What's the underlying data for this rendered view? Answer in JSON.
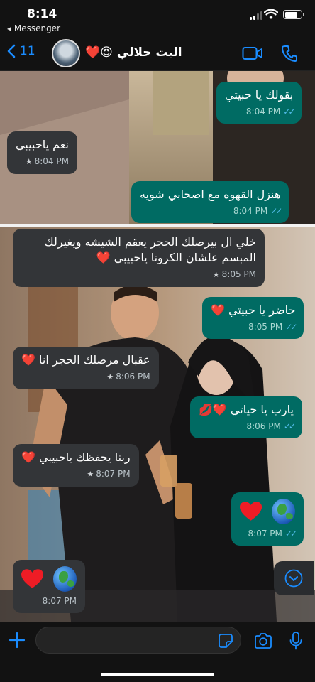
{
  "status_bar": {
    "time": "8:14",
    "back_app": "◂ Messenger"
  },
  "header": {
    "back_count": "11",
    "contact_name": "البت حلالي 😍❤️"
  },
  "messages": [
    {
      "dir": "out",
      "text": "بقولك يا حبيتي",
      "time": "8:04 PM"
    },
    {
      "dir": "in",
      "text": "نعم ياحبيبي",
      "time": "8:04 PM",
      "starred": true
    },
    {
      "dir": "out",
      "text": "هنزل القهوه مع اصحابي شويه",
      "time": "8:04 PM"
    },
    {
      "dir": "in",
      "text_line1": "خلي ال بيرصلك الحجر يعقم الشيشه ويغيرلك",
      "text_line2": "المبسم علشان الكرونا ياحبيبي ❤️",
      "time": "8:05 PM",
      "starred": true
    },
    {
      "dir": "out",
      "text": "حاضر يا حبيتي ❤️",
      "time": "8:05 PM"
    },
    {
      "dir": "in",
      "text": "عقبال مرصلك الحجر انا ❤️",
      "time": "8:06 PM",
      "starred": true
    },
    {
      "dir": "out",
      "text": "يارب يا حياتي ❤️💋",
      "time": "8:06 PM"
    },
    {
      "dir": "in",
      "text": "ربنا يحفظك ياحبيبي ❤️",
      "time": "8:07 PM",
      "starred": true
    },
    {
      "dir": "out",
      "emoji": "❤️🌍",
      "time": "8:07 PM"
    },
    {
      "dir": "in",
      "emoji": "❤️🌍",
      "time": "8:07 PM"
    }
  ],
  "colors": {
    "accent": "#1a8cff",
    "outgoing": "#006b63",
    "incoming": "#333538",
    "read_tick": "#53bdeb"
  }
}
